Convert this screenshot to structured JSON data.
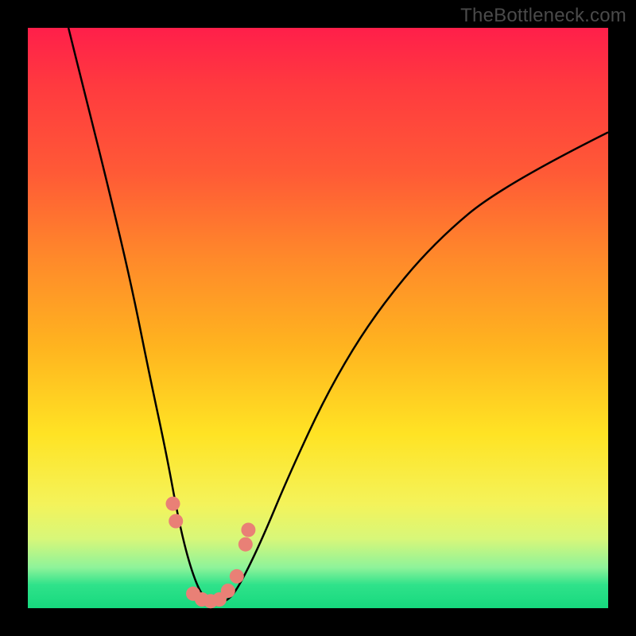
{
  "watermark": "TheBottleneck.com",
  "colors": {
    "frame": "#000000",
    "gradient_top": "#ff1f4a",
    "gradient_mid1": "#ff8a2a",
    "gradient_mid2": "#ffe324",
    "gradient_bottom": "#16d97e",
    "curve": "#000000",
    "marker": "#e98076"
  },
  "chart_data": {
    "type": "line",
    "title": "",
    "xlabel": "",
    "ylabel": "",
    "xlim": [
      0,
      100
    ],
    "ylim": [
      0,
      100
    ],
    "grid": false,
    "legend": false,
    "series": [
      {
        "name": "bottleneck-curve",
        "x": [
          7,
          10,
          14,
          18,
          21,
          24,
          26,
          28,
          30,
          32,
          34,
          36,
          40,
          45,
          52,
          60,
          70,
          82,
          100
        ],
        "values": [
          100,
          88,
          72,
          55,
          40,
          26,
          15,
          7,
          2,
          1,
          1,
          3,
          11,
          23,
          38,
          51,
          63,
          73,
          82
        ]
      }
    ],
    "markers": [
      {
        "x": 25.0,
        "y": 18
      },
      {
        "x": 25.5,
        "y": 15
      },
      {
        "x": 28.5,
        "y": 2.5
      },
      {
        "x": 30.0,
        "y": 1.5
      },
      {
        "x": 31.5,
        "y": 1.2
      },
      {
        "x": 33.0,
        "y": 1.5
      },
      {
        "x": 34.5,
        "y": 3.0
      },
      {
        "x": 36.0,
        "y": 5.5
      },
      {
        "x": 37.5,
        "y": 11.0
      },
      {
        "x": 38.0,
        "y": 13.5
      }
    ],
    "marker_radius_px": 9,
    "notes": "V-shaped bottleneck curve over a red-to-green vertical gradient. Values estimated from pixel positions; y=0 is bottom (green), y=100 is top (red). Markers are salmon-colored dots clustered at and around the trough."
  }
}
